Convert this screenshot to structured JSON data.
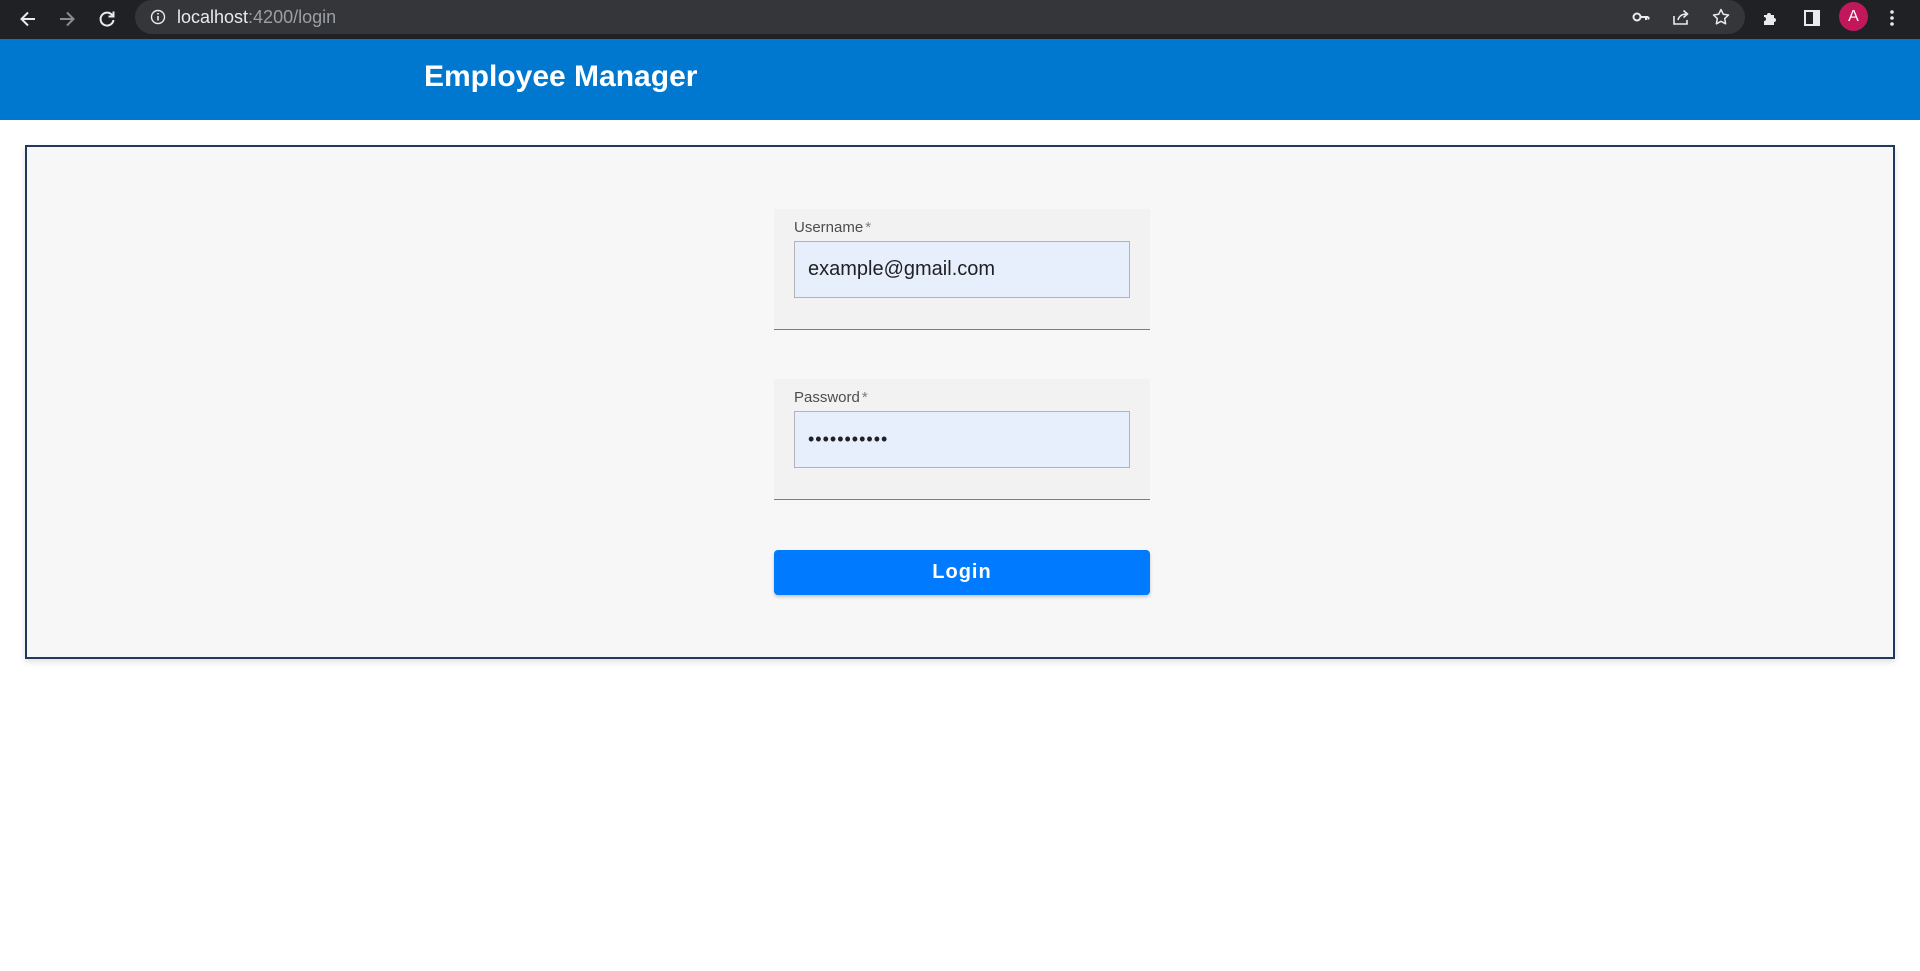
{
  "browser": {
    "url_host": "localhost",
    "url_path": ":4200/login",
    "profile_initial": "A",
    "icons": {
      "back": "back-arrow-icon",
      "forward": "forward-arrow-icon",
      "reload": "reload-icon",
      "site_info": "info-icon",
      "password": "key-icon",
      "share": "share-icon",
      "bookmark": "star-icon",
      "extensions": "puzzle-icon",
      "side_panel": "side-panel-icon",
      "menu": "kebab-menu-icon"
    }
  },
  "header": {
    "title": "Employee Manager",
    "background_color": "#0078d0"
  },
  "form": {
    "username": {
      "label": "Username",
      "required_marker": "*",
      "value": "example@gmail.com"
    },
    "password": {
      "label": "Password",
      "required_marker": "*",
      "value": "examplepass"
    },
    "submit_label": "Login",
    "submit_color": "#007bff"
  }
}
